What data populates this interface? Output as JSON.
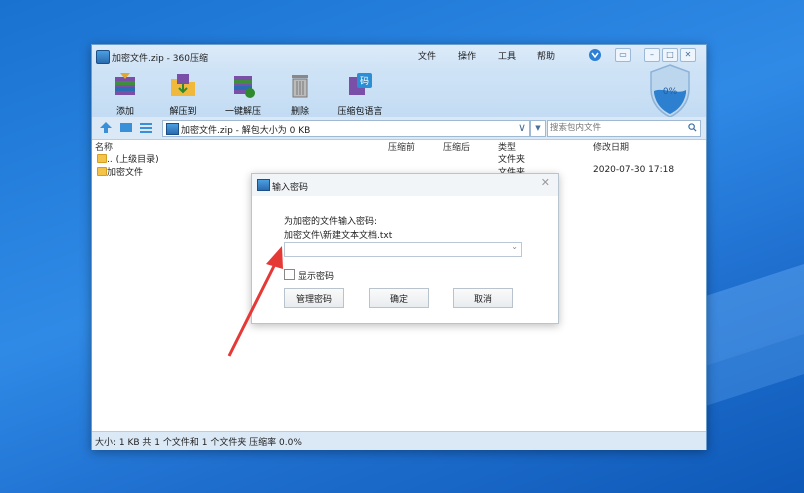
{
  "window": {
    "title": "加密文件.zip - 360压缩",
    "menus": [
      "文件",
      "操作",
      "工具",
      "帮助"
    ],
    "shield_label": "0%"
  },
  "toolbar": {
    "add": "添加",
    "extract_to": "解压到",
    "one_click_extract": "一键解压",
    "delete": "删除",
    "language": "压缩包语言"
  },
  "addressbar": {
    "path": "加密文件.zip - 解包大小为 0 KB",
    "search_placeholder": "搜索包内文件"
  },
  "columns": {
    "name": "名称",
    "before": "压缩前",
    "after": "压缩后",
    "type": "类型",
    "modified": "修改日期"
  },
  "rows": [
    {
      "name": ".. (上级目录)",
      "type": "文件夹",
      "modified": ""
    },
    {
      "name": "加密文件",
      "type": "文件夹",
      "modified": "2020-07-30 17:18"
    }
  ],
  "status": "大小: 1 KB 共 1 个文件和 1 个文件夹 压缩率 0.0%",
  "dialog": {
    "title": "输入密码",
    "prompt": "为加密的文件输入密码:",
    "file_path": "加密文件\\新建文本文档.txt",
    "password_value": "",
    "show_password": "显示密码",
    "manage_button": "管理密码",
    "ok_button": "确定",
    "cancel_button": "取消"
  },
  "colors": {
    "accent": "#2f8ae6",
    "arrow": "#e53935"
  }
}
